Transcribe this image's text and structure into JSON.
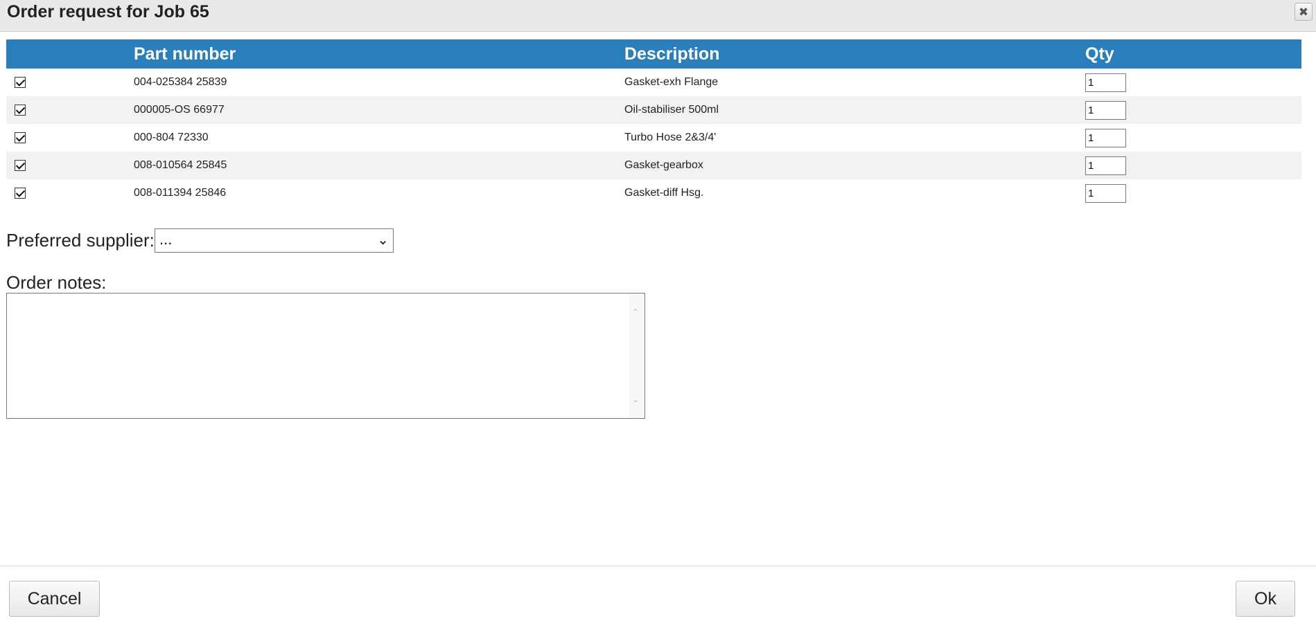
{
  "dialog": {
    "title": "Order request for Job 65",
    "close_icon": "close-icon"
  },
  "table": {
    "columns": [
      "",
      "Part number",
      "Description",
      "Qty"
    ],
    "rows": [
      {
        "checked": true,
        "part_number": "004-025384 25839",
        "description": "Gasket-exh Flange",
        "qty": "1"
      },
      {
        "checked": true,
        "part_number": "000005-OS 66977",
        "description": "Oil-stabiliser 500ml",
        "qty": "1"
      },
      {
        "checked": true,
        "part_number": "000-804 72330",
        "description": "Turbo Hose 2&3/4'",
        "qty": "1"
      },
      {
        "checked": true,
        "part_number": "008-010564 25845",
        "description": "Gasket-gearbox",
        "qty": "1"
      },
      {
        "checked": true,
        "part_number": "008-011394 25846",
        "description": "Gasket-diff Hsg.",
        "qty": "1"
      }
    ]
  },
  "supplier": {
    "label": "Preferred supplier:",
    "selected": "..."
  },
  "notes": {
    "label": "Order notes:",
    "value": ""
  },
  "footer": {
    "cancel_label": "Cancel",
    "ok_label": "Ok"
  },
  "colors": {
    "header_bg": "#2a7fba",
    "stripe_bg": "#f2f2f2",
    "titlebar_bg": "#e9e9e9"
  }
}
